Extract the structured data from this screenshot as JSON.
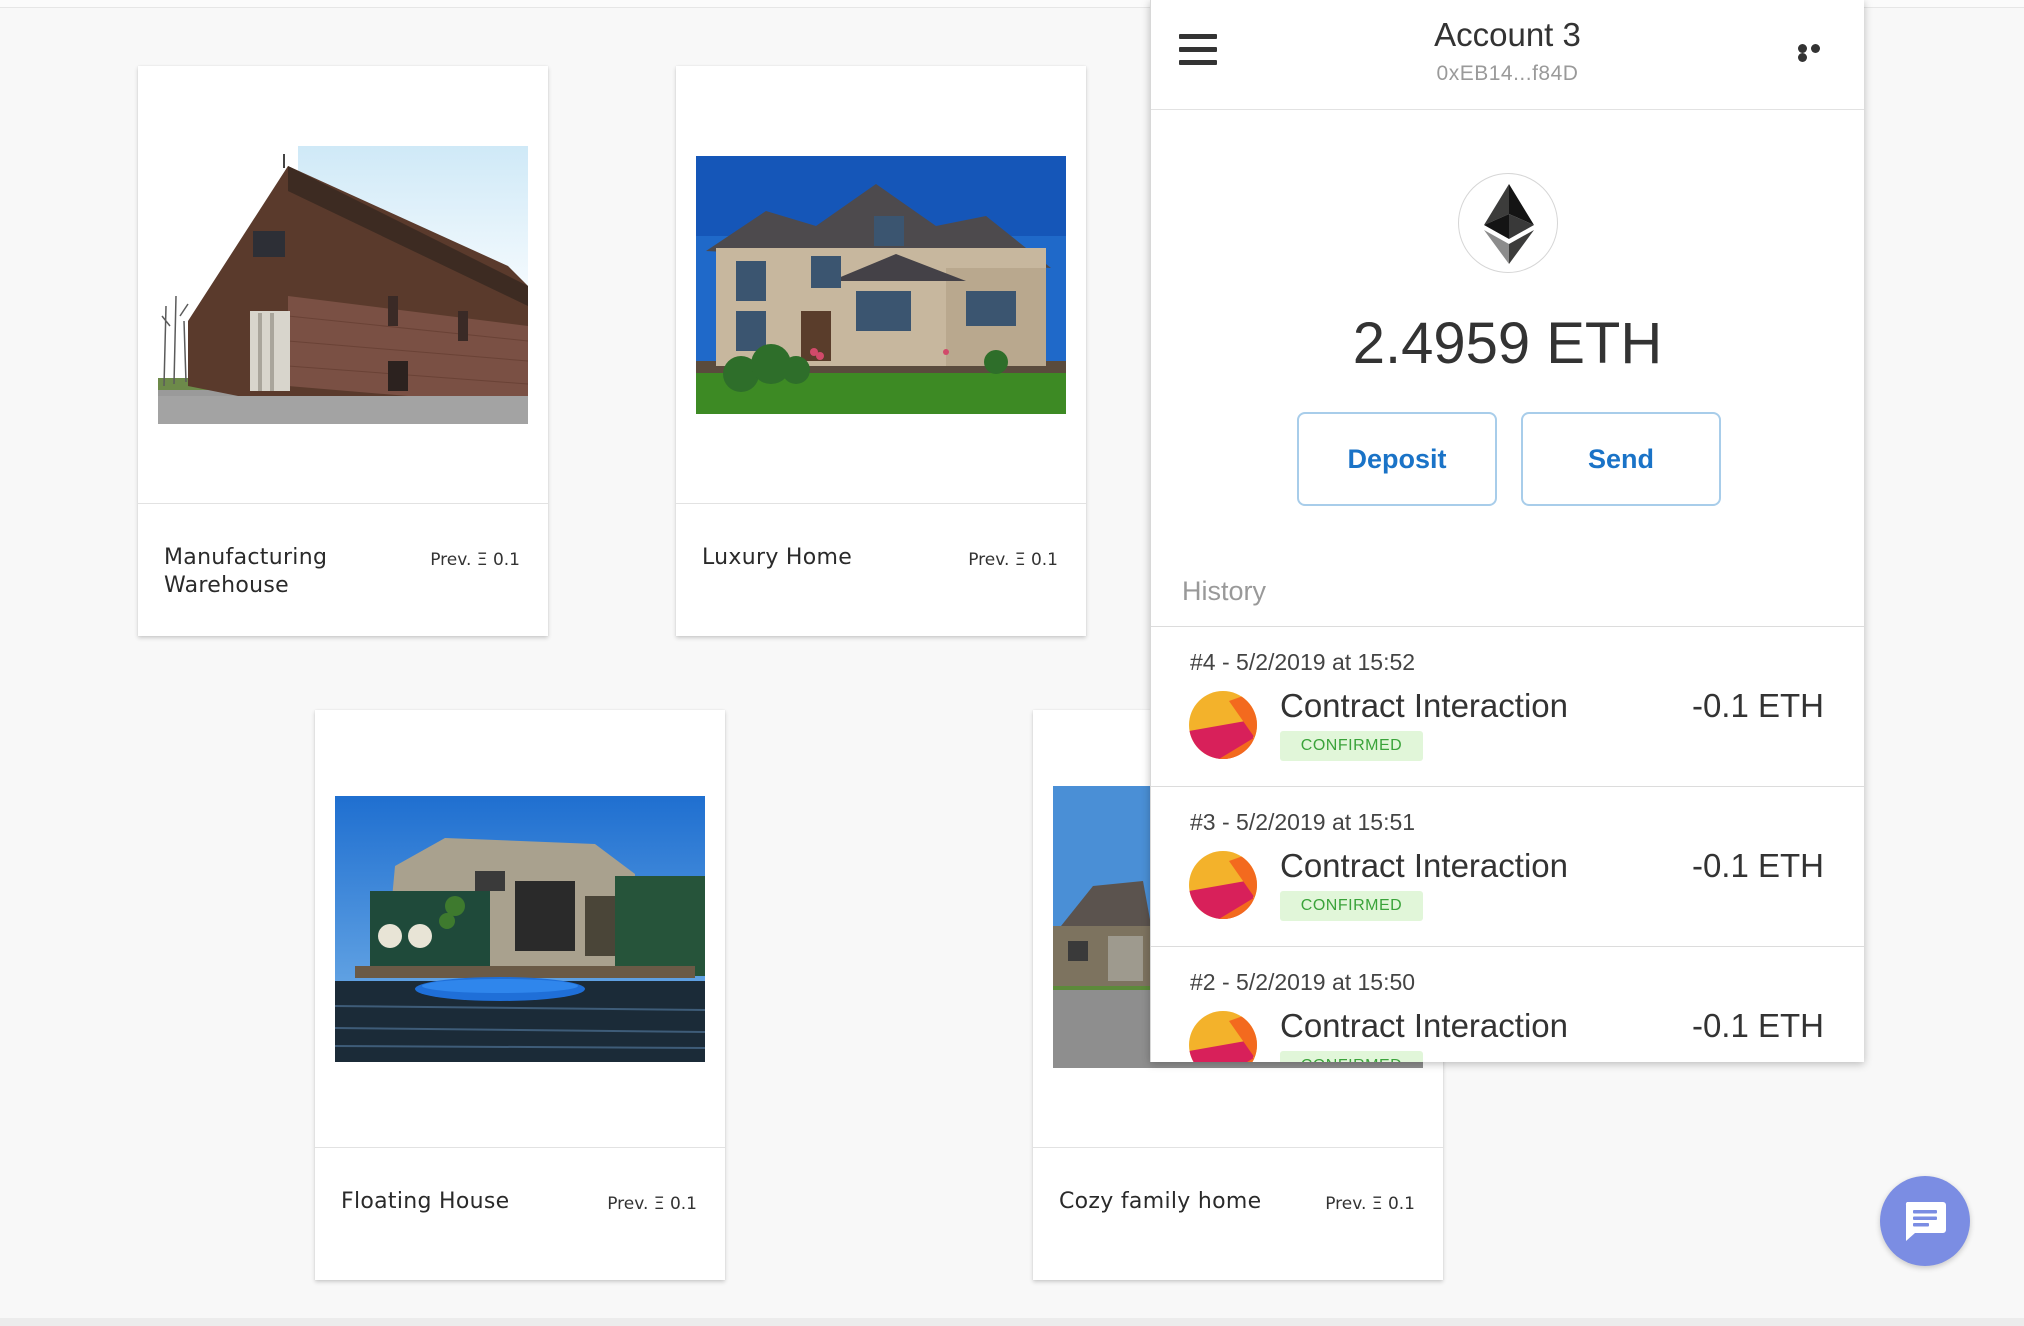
{
  "listings": [
    {
      "name_line1": "Manufacturing",
      "name_line2": "Warehouse",
      "price": "Prev. Ξ 0.1",
      "image": "warehouse-photo"
    },
    {
      "name_line1": "Luxury Home",
      "name_line2": "",
      "price": "Prev. Ξ 0.1",
      "image": "house-photo"
    },
    {
      "name_line1": "Floating House",
      "name_line2": "",
      "price": "Prev. Ξ 0.1",
      "image": "houseboat-photo"
    },
    {
      "name_line1": "Cozy family home",
      "name_line2": "",
      "price": "Prev. Ξ 0.1",
      "image": "family-home-photo"
    }
  ],
  "wallet": {
    "account_name": "Account 3",
    "address": "0xEB14...f84D",
    "balance": "2.4959 ETH",
    "deposit_label": "Deposit",
    "send_label": "Send",
    "history_label": "History",
    "icons": {
      "menu": "hamburger-menu-icon",
      "more": "more-options-icon",
      "token": "ethereum-icon"
    },
    "transactions": [
      {
        "date": "#4 - 5/2/2019 at 15:52",
        "title": "Contract Interaction",
        "amount": "-0.1 ETH",
        "status": "CONFIRMED"
      },
      {
        "date": "#3 - 5/2/2019 at 15:51",
        "title": "Contract Interaction",
        "amount": "-0.1 ETH",
        "status": "CONFIRMED"
      },
      {
        "date": "#2 - 5/2/2019 at 15:50",
        "title": "Contract Interaction",
        "amount": "-0.1 ETH",
        "status": "CONFIRMED"
      }
    ]
  },
  "chat": {
    "icon": "chat-bubble-icon"
  },
  "colors": {
    "accent": "#1a73c7",
    "button_border": "#a8cdea",
    "confirmed_bg": "#e1f6d9",
    "confirmed_text": "#3aa33a",
    "chat_button": "#7b8de3"
  }
}
